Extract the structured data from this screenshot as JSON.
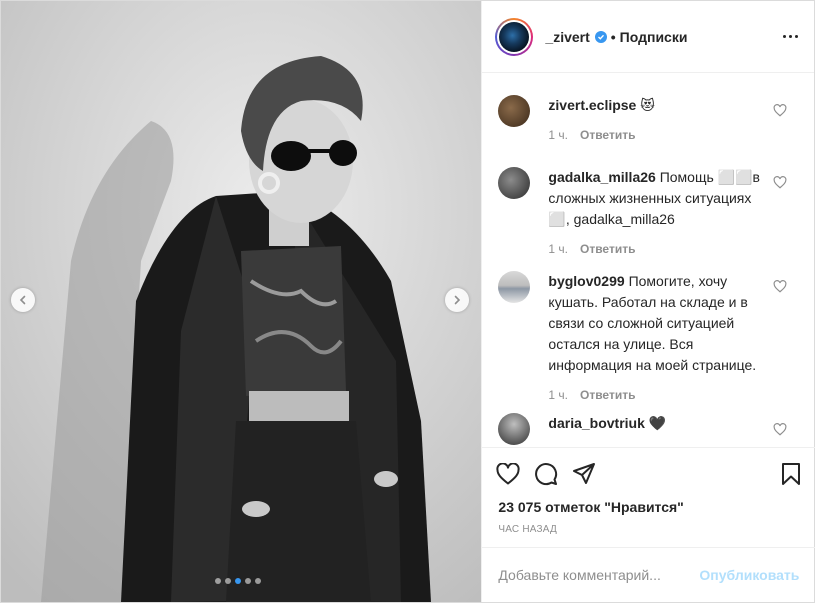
{
  "header": {
    "username": "_zivert",
    "separator": "•",
    "follow_label": "Подписки"
  },
  "comments": [
    {
      "username": "zivert.eclipse",
      "text": "😻",
      "time": "1 ч.",
      "reply": "Ответить"
    },
    {
      "username": "gadalka_milla26",
      "text": "Помощь ⬜⬜в сложных жизненных ситуациях ⬜, gadalka_milla26",
      "time": "1 ч.",
      "reply": "Ответить"
    },
    {
      "username": "byglov0299",
      "text": "Помогите, хочу кушать. Работал на складе и в связи со сложной ситуацией остался на улице. Вся информация на моей странице.",
      "time": "1 ч.",
      "reply": "Ответить"
    },
    {
      "username": "daria_bovtriuk",
      "text": "🖤",
      "time": "",
      "reply": ""
    }
  ],
  "likes": "23 075 отметок \"Нравится\"",
  "time_ago": "ЧАС НАЗАД",
  "add_comment": {
    "placeholder": "Добавьте комментарий...",
    "publish_label": "Опубликовать"
  },
  "carousel": {
    "total": 5,
    "active_index": 2
  },
  "icons": {
    "prev": "chevron-left-icon",
    "next": "chevron-right-icon",
    "like": "heart-icon",
    "comment": "comment-icon",
    "share": "share-icon",
    "save": "bookmark-icon",
    "more": "more-icon",
    "verified": "verified-icon"
  },
  "colors": {
    "accent": "#3897f0",
    "publish_disabled": "#b2dffc",
    "muted": "#8e8e8e"
  }
}
